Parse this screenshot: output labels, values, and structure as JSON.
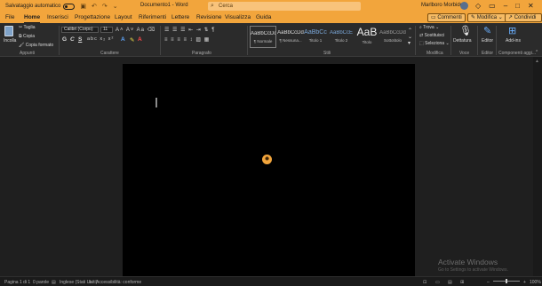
{
  "titlebar": {
    "autosave_label": "Salvataggio automatico",
    "doc_title": "Documento1 - Word",
    "search_placeholder": "Cerca",
    "user_name": "Marlboro Morbide"
  },
  "menu": {
    "items": [
      "File",
      "Home",
      "Inserisci",
      "Progettazione",
      "Layout",
      "Riferimenti",
      "Lettere",
      "Revisione",
      "Visualizza",
      "Guida"
    ],
    "active": "Home",
    "comments_label": "Commenti",
    "editing_label": "Modifica",
    "share_label": "Condividi"
  },
  "ribbon": {
    "clipboard": {
      "paste": "Incolla",
      "cut": "Taglia",
      "copy": "Copia",
      "format_painter": "Copia formato",
      "group": "Appunti"
    },
    "font": {
      "name": "Calibri (Corpo)",
      "size": "11",
      "group": "Carattere"
    },
    "paragraph": {
      "group": "Paragrafo"
    },
    "styles": {
      "items": [
        {
          "sample": "AaBbCcDd",
          "name": "¶ Normale"
        },
        {
          "sample": "AaBbCcDd",
          "name": "¶ Nessuna..."
        },
        {
          "sample": "AaBbCc",
          "name": "Titolo 1"
        },
        {
          "sample": "AaBbCcE",
          "name": "Titolo 2"
        },
        {
          "sample": "AaB",
          "name": "Titolo"
        },
        {
          "sample": "AaBbCcDd",
          "name": "Sottotitolo"
        }
      ],
      "group": "Stili"
    },
    "editing": {
      "find": "Trova",
      "replace": "Sostituisci",
      "select": "Seleziona",
      "group": "Modifica"
    },
    "voice": {
      "dictate": "Dettatura",
      "group": "Voce"
    },
    "editor": {
      "label": "Editor",
      "group": "Editor"
    },
    "addins": {
      "label": "Add-ins",
      "group": "Componenti aggi..."
    }
  },
  "watermark": {
    "title": "Activate Windows",
    "subtitle": "Go to Settings to activate Windows."
  },
  "status": {
    "page": "Pagina 1 di 1",
    "words": "0 parole",
    "language": "Inglese (Stati Uniti)",
    "accessibility": "Accessibilità: conforme",
    "zoom": "100%"
  }
}
